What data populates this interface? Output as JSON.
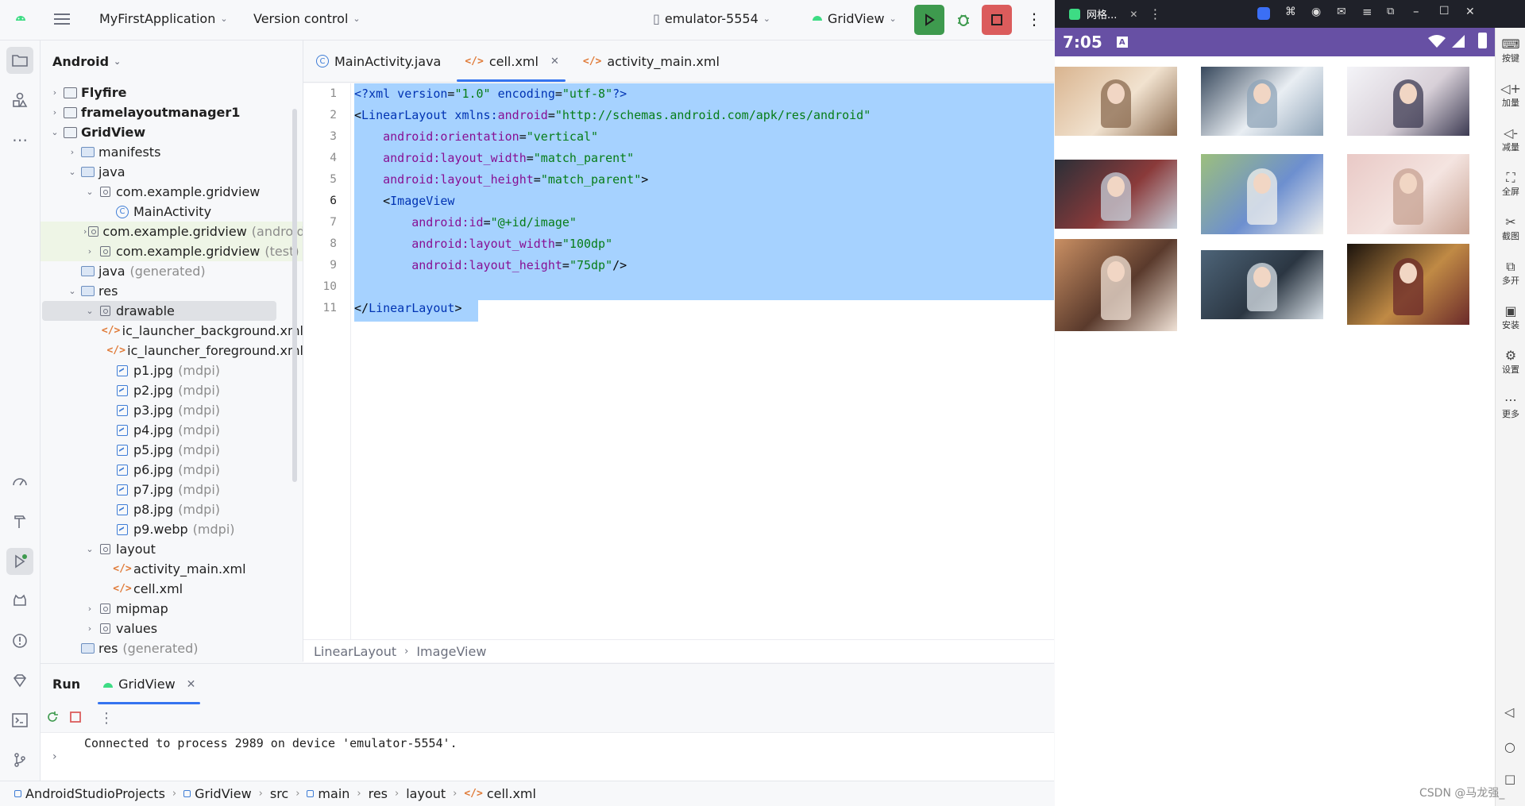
{
  "topbar": {
    "project_name": "MyFirstApplication",
    "vcs": "Version control",
    "device": "emulator-5554",
    "run_config": "GridView"
  },
  "project_panel": {
    "view_mode": "Android",
    "tree": [
      {
        "label": "Flyfire",
        "secondary": "",
        "depth": 0,
        "arrow": "›",
        "icon": "module",
        "bold": true
      },
      {
        "label": "framelayoutmanager1",
        "secondary": "",
        "depth": 0,
        "arrow": "›",
        "icon": "module",
        "bold": true
      },
      {
        "label": "GridView",
        "secondary": "",
        "depth": 0,
        "arrow": "⌄",
        "icon": "module",
        "bold": true
      },
      {
        "label": "manifests",
        "secondary": "",
        "depth": 1,
        "arrow": "›",
        "icon": "folder"
      },
      {
        "label": "java",
        "secondary": "",
        "depth": 1,
        "arrow": "⌄",
        "icon": "folder"
      },
      {
        "label": "com.example.gridview",
        "secondary": "",
        "depth": 2,
        "arrow": "⌄",
        "icon": "package"
      },
      {
        "label": "MainActivity",
        "secondary": "",
        "depth": 3,
        "arrow": "",
        "icon": "class"
      },
      {
        "label": "com.example.gridview",
        "secondary": "(androidTest)",
        "depth": 2,
        "arrow": "›",
        "icon": "package",
        "green": true
      },
      {
        "label": "com.example.gridview",
        "secondary": "(test)",
        "depth": 2,
        "arrow": "›",
        "icon": "package",
        "green": true
      },
      {
        "label": "java",
        "secondary": "(generated)",
        "depth": 1,
        "arrow": "",
        "icon": "folder"
      },
      {
        "label": "res",
        "secondary": "",
        "depth": 1,
        "arrow": "⌄",
        "icon": "folder"
      },
      {
        "label": "drawable",
        "secondary": "",
        "depth": 2,
        "arrow": "⌄",
        "icon": "package",
        "selected": true
      },
      {
        "label": "ic_launcher_background.xml",
        "secondary": "",
        "depth": 3,
        "arrow": "",
        "icon": "xml"
      },
      {
        "label": "ic_launcher_foreground.xml",
        "secondary": "",
        "depth": 3,
        "arrow": "",
        "icon": "xml"
      },
      {
        "label": "p1.jpg",
        "secondary": "(mdpi)",
        "depth": 3,
        "arrow": "",
        "icon": "image"
      },
      {
        "label": "p2.jpg",
        "secondary": "(mdpi)",
        "depth": 3,
        "arrow": "",
        "icon": "image"
      },
      {
        "label": "p3.jpg",
        "secondary": "(mdpi)",
        "depth": 3,
        "arrow": "",
        "icon": "image"
      },
      {
        "label": "p4.jpg",
        "secondary": "(mdpi)",
        "depth": 3,
        "arrow": "",
        "icon": "image"
      },
      {
        "label": "p5.jpg",
        "secondary": "(mdpi)",
        "depth": 3,
        "arrow": "",
        "icon": "image"
      },
      {
        "label": "p6.jpg",
        "secondary": "(mdpi)",
        "depth": 3,
        "arrow": "",
        "icon": "image"
      },
      {
        "label": "p7.jpg",
        "secondary": "(mdpi)",
        "depth": 3,
        "arrow": "",
        "icon": "image"
      },
      {
        "label": "p8.jpg",
        "secondary": "(mdpi)",
        "depth": 3,
        "arrow": "",
        "icon": "image"
      },
      {
        "label": "p9.webp",
        "secondary": "(mdpi)",
        "depth": 3,
        "arrow": "",
        "icon": "image"
      },
      {
        "label": "layout",
        "secondary": "",
        "depth": 2,
        "arrow": "⌄",
        "icon": "package"
      },
      {
        "label": "activity_main.xml",
        "secondary": "",
        "depth": 3,
        "arrow": "",
        "icon": "xml"
      },
      {
        "label": "cell.xml",
        "secondary": "",
        "depth": 3,
        "arrow": "",
        "icon": "xml"
      },
      {
        "label": "mipmap",
        "secondary": "",
        "depth": 2,
        "arrow": "›",
        "icon": "package"
      },
      {
        "label": "values",
        "secondary": "",
        "depth": 2,
        "arrow": "›",
        "icon": "package"
      },
      {
        "label": "res",
        "secondary": "(generated)",
        "depth": 1,
        "arrow": "",
        "icon": "folder"
      }
    ]
  },
  "editor": {
    "tabs": [
      {
        "label": "MainActivity.java",
        "icon": "class",
        "active": false
      },
      {
        "label": "cell.xml",
        "icon": "xml",
        "active": true
      },
      {
        "label": "activity_main.xml",
        "icon": "xml",
        "active": false
      }
    ],
    "line_numbers": [
      "1",
      "2",
      "3",
      "4",
      "5",
      "6",
      "7",
      "8",
      "9",
      "10",
      "11"
    ],
    "lines": [
      [
        {
          "t": "<?",
          "c": "tag"
        },
        {
          "t": "xml version",
          "c": "tag"
        },
        {
          "t": "=",
          "c": ""
        },
        {
          "t": "\"1.0\"",
          "c": "val"
        },
        {
          "t": " encoding",
          "c": "tag"
        },
        {
          "t": "=",
          "c": ""
        },
        {
          "t": "\"utf-8\"",
          "c": "val"
        },
        {
          "t": "?>",
          "c": "tag"
        }
      ],
      [
        {
          "t": "<",
          "c": ""
        },
        {
          "t": "LinearLayout",
          "c": "tag"
        },
        {
          "t": " xmlns:",
          "c": "tag"
        },
        {
          "t": "android",
          "c": "ns"
        },
        {
          "t": "=",
          "c": ""
        },
        {
          "t": "\"http://schemas.android.com/apk/res/android\"",
          "c": "val"
        }
      ],
      [
        {
          "t": "    ",
          "c": ""
        },
        {
          "t": "android",
          "c": "ns"
        },
        {
          "t": ":orientation",
          "c": "ns"
        },
        {
          "t": "=",
          "c": ""
        },
        {
          "t": "\"vertical\"",
          "c": "val"
        }
      ],
      [
        {
          "t": "    ",
          "c": ""
        },
        {
          "t": "android",
          "c": "ns"
        },
        {
          "t": ":layout_width",
          "c": "ns"
        },
        {
          "t": "=",
          "c": ""
        },
        {
          "t": "\"match_parent\"",
          "c": "val"
        }
      ],
      [
        {
          "t": "    ",
          "c": ""
        },
        {
          "t": "android",
          "c": "ns"
        },
        {
          "t": ":layout_height",
          "c": "ns"
        },
        {
          "t": "=",
          "c": ""
        },
        {
          "t": "\"match_parent\"",
          "c": "val"
        },
        {
          "t": ">",
          "c": ""
        }
      ],
      [
        {
          "t": "    <",
          "c": ""
        },
        {
          "t": "ImageView",
          "c": "tag"
        }
      ],
      [
        {
          "t": "        ",
          "c": ""
        },
        {
          "t": "android",
          "c": "ns"
        },
        {
          "t": ":id",
          "c": "ns"
        },
        {
          "t": "=",
          "c": ""
        },
        {
          "t": "\"@+id/image\"",
          "c": "val"
        }
      ],
      [
        {
          "t": "        ",
          "c": ""
        },
        {
          "t": "android",
          "c": "ns"
        },
        {
          "t": ":layout_width",
          "c": "ns"
        },
        {
          "t": "=",
          "c": ""
        },
        {
          "t": "\"100dp\"",
          "c": "val"
        }
      ],
      [
        {
          "t": "        ",
          "c": ""
        },
        {
          "t": "android",
          "c": "ns"
        },
        {
          "t": ":layout_height",
          "c": "ns"
        },
        {
          "t": "=",
          "c": ""
        },
        {
          "t": "\"75dp\"",
          "c": "val"
        },
        {
          "t": "/>",
          "c": ""
        }
      ],
      [],
      [
        {
          "t": "</",
          "c": ""
        },
        {
          "t": "LinearLayout",
          "c": "tag"
        },
        {
          "t": ">",
          "c": ""
        }
      ]
    ],
    "breadcrumb": [
      "LinearLayout",
      "ImageView"
    ]
  },
  "run_panel": {
    "title": "Run",
    "tab_label": "GridView",
    "console_text": "Connected to process 2989 on device 'emulator-5554'."
  },
  "statusbar": {
    "path": [
      "AndroidStudioProjects",
      "GridView",
      "src",
      "main",
      "res",
      "layout",
      "cell.xml"
    ]
  },
  "emulator": {
    "window_title": "网格...",
    "time": "7:05",
    "side_buttons": [
      "按键",
      "加量",
      "减量",
      "全屏",
      "截图",
      "多开",
      "安装",
      "设置",
      "更多"
    ],
    "photos": [
      {
        "name": "photo-1",
        "colors": [
          "#d9b48f",
          "#8a6a4f",
          "#f1e2cf"
        ]
      },
      {
        "name": "photo-2",
        "colors": [
          "#37485c",
          "#8fa4b8",
          "#e9eef3"
        ]
      },
      {
        "name": "photo-3",
        "colors": [
          "#f4f4f8",
          "#3c3a52",
          "#d8d0d8"
        ]
      },
      {
        "name": "photo-4",
        "colors": [
          "#2a2f38",
          "#c7d0db",
          "#8a3a3a"
        ]
      },
      {
        "name": "photo-5",
        "colors": [
          "#9cbf7d",
          "#f1f1ee",
          "#6d8fcf"
        ]
      },
      {
        "name": "photo-6",
        "colors": [
          "#e9c9c6",
          "#c7a191",
          "#f4e4e0"
        ]
      },
      {
        "name": "photo-7",
        "colors": [
          "#c98f63",
          "#f0e2d6",
          "#5a3a2c"
        ]
      },
      {
        "name": "photo-8",
        "colors": [
          "#4d6478",
          "#d9e1e8",
          "#2b3642"
        ]
      },
      {
        "name": "photo-9",
        "colors": [
          "#1a120c",
          "#6b2a2a",
          "#c08a45"
        ]
      }
    ]
  },
  "watermark": "CSDN @马龙强_",
  "colors": {
    "accent": "#3574f0",
    "run_green": "#3e9a4e",
    "stop_red": "#db5c5c",
    "emulator_status": "#6750a4",
    "selection": "#a6d2ff"
  }
}
